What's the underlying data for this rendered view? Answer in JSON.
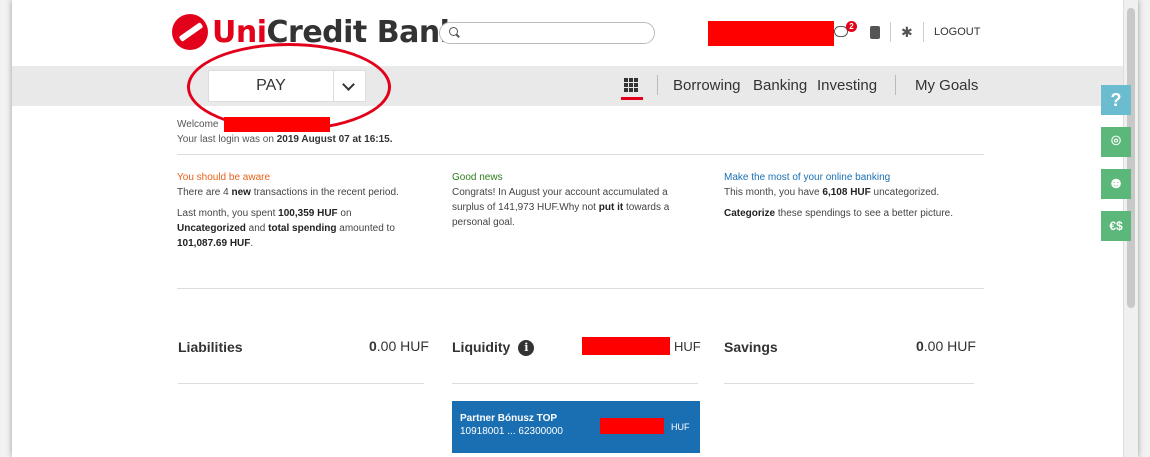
{
  "header": {
    "brand_uni": "Uni",
    "brand_rest": "Credit Bank",
    "search_placeholder": "",
    "notification_count": "2",
    "logout_label": "LOGOUT"
  },
  "nav": {
    "pay_label": "PAY",
    "links": [
      "Borrowing",
      "Banking",
      "Investing",
      "My Goals"
    ]
  },
  "welcome": {
    "prefix": "Welcome",
    "last_login_prefix": "Your last login was on ",
    "last_login_date": "2019 August 07 at 16:15."
  },
  "insights": {
    "aware": {
      "title": "You should be aware",
      "line1_a": "There are 4 ",
      "line1_b": "new",
      "line1_c": " transactions in the recent period.",
      "line2_a": "Last month, you spent ",
      "line2_b": "100,359 HUF",
      "line2_c": " on",
      "line3_a": "Uncategorized",
      "line3_b": " and ",
      "line3_c": "total spending",
      "line3_d": " amounted to",
      "line4": "101,087.69 HUF",
      "line4_end": "."
    },
    "good": {
      "title": "Good news",
      "line1": "Congrats! In August  your account accumulated a",
      "line2_a": "surplus of 141,973 HUF.Why not ",
      "line2_b": "put it",
      "line2_c": " towards a",
      "line3": "personal goal."
    },
    "online": {
      "title": "Make the most of your online banking",
      "line1_a": "This month, you have ",
      "line1_b": "6,108 HUF",
      "line1_c": " uncategorized.",
      "line2_a": "Categorize",
      "line2_b": " these spendings to see a better picture."
    }
  },
  "summary": {
    "liabilities_label": "Liabilities",
    "liabilities_int": "0",
    "liabilities_rest": ".00 HUF",
    "liquidity_label": "Liquidity",
    "liquidity_info": "i",
    "liquidity_currency": "HUF",
    "savings_label": "Savings",
    "savings_int": "0",
    "savings_rest": ".00 HUF"
  },
  "account_card": {
    "name": "Partner Bónusz TOP",
    "number": "10918001 ... 62300000",
    "currency": "HUF"
  },
  "side_buttons": {
    "help": "?",
    "currency": "€$"
  },
  "colors": {
    "brand_red": "#e2001a",
    "nav_gray": "#e9e9e9",
    "card_blue": "#1a6fb3",
    "side_green": "#5cb87a",
    "side_help": "#6cbcd0",
    "aware_orange": "#e8611c",
    "good_green": "#2d7d1a"
  }
}
